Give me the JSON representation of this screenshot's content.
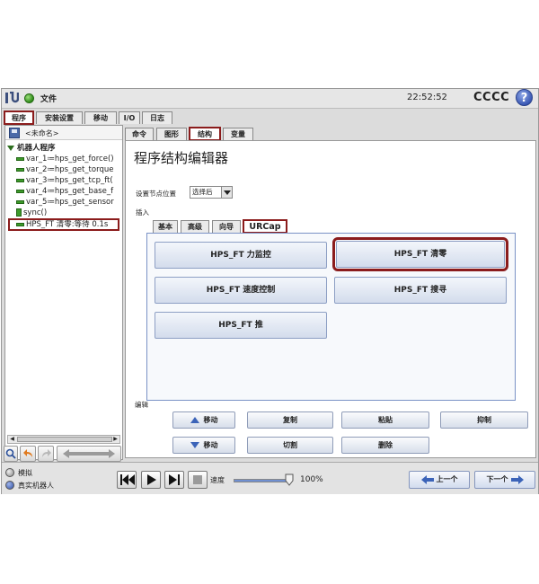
{
  "topbar": {
    "file_menu": "文件",
    "clock": "22:52:52",
    "robot_name": "CCCC",
    "help_glyph": "?"
  },
  "main_tabs": [
    {
      "label": "程序",
      "active": true
    },
    {
      "label": "安装设置",
      "active": false
    },
    {
      "label": "移动",
      "active": false
    },
    {
      "label": "I/O",
      "active": false
    },
    {
      "label": "日志",
      "active": false
    }
  ],
  "program": {
    "name": "<未命名>",
    "root_label": "机器人程序",
    "nodes": [
      {
        "label": "var_1≔hps_get_force()",
        "type": "assign"
      },
      {
        "label": "var_2≔hps_get_torque",
        "type": "assign"
      },
      {
        "label": "var_3≔hps_get_tcp_ft(",
        "type": "assign"
      },
      {
        "label": "var_4≔hps_get_base_f",
        "type": "assign"
      },
      {
        "label": "var_5≔hps_get_sensor",
        "type": "assign"
      },
      {
        "label": "sync()",
        "type": "sync"
      },
      {
        "label": "HPS_FT 清零:等待 0.1s",
        "type": "urcap",
        "selected": true
      }
    ]
  },
  "structure_tabs": [
    {
      "label": "命令",
      "active": false
    },
    {
      "label": "图形",
      "active": false
    },
    {
      "label": "结构",
      "active": true
    },
    {
      "label": "变量",
      "active": false
    }
  ],
  "editor": {
    "title": "程序结构编辑器",
    "insert_position_label": "设置节点位置",
    "insert_position_value": "选择后",
    "insert_label": "插入",
    "insert_tabs": [
      {
        "label": "基本",
        "active": false
      },
      {
        "label": "高级",
        "active": false
      },
      {
        "label": "向导",
        "active": false
      },
      {
        "label": "URCap",
        "active": true
      }
    ],
    "urcap_buttons": [
      {
        "label": "HPS_FT 力监控",
        "highlighted": false
      },
      {
        "label": "HPS_FT 清零",
        "highlighted": true
      },
      {
        "label": "HPS_FT 速度控制",
        "highlighted": false
      },
      {
        "label": "HPS_FT 搜寻",
        "highlighted": false
      },
      {
        "label": "HPS_FT 推",
        "highlighted": false
      }
    ],
    "edit_label": "编辑",
    "edit_buttons": {
      "move_up": "移动",
      "copy": "复制",
      "paste": "粘贴",
      "suppress": "抑制",
      "move_down": "移动",
      "cut": "切割",
      "delete": "删除"
    }
  },
  "bottombar": {
    "mode_simulation": "模拟",
    "mode_real_robot": "真实机器人",
    "speed_label": "速度",
    "speed_value": "100%",
    "speed_fraction": 1.0,
    "prev_button": "上一个",
    "next_button": "下一个"
  },
  "colors": {
    "highlight_red": "#8b1c1c",
    "accent_blue": "#3b63b8",
    "status_green": "#2f8a1a"
  }
}
